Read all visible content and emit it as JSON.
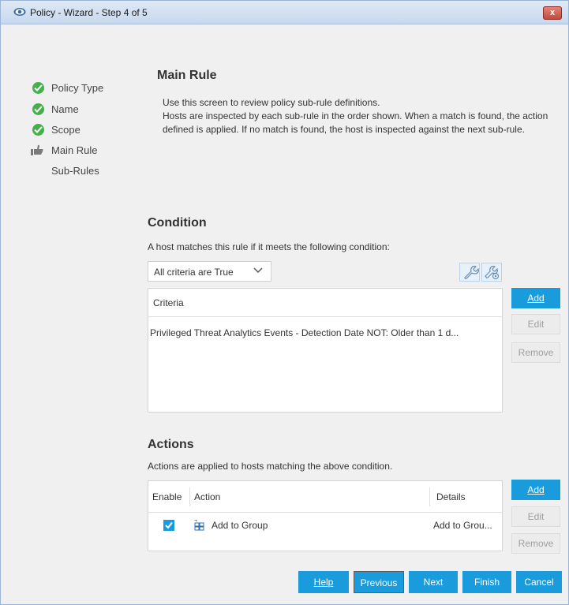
{
  "window": {
    "title": "Policy - Wizard - Step 4 of 5",
    "close_label": "x"
  },
  "steps": [
    {
      "label": "Policy Type",
      "state": "done"
    },
    {
      "label": "Name",
      "state": "done"
    },
    {
      "label": "Scope",
      "state": "done"
    },
    {
      "label": "Main Rule",
      "state": "current"
    },
    {
      "label": "Sub-Rules",
      "state": "pending"
    }
  ],
  "main": {
    "title": "Main Rule",
    "description_1": "Use this screen to review policy sub-rule definitions.",
    "description_2": "Hosts are inspected by each sub-rule in the order shown. When a match is found, the action defined is applied. If no match is found, the host is inspected against the next sub-rule."
  },
  "condition": {
    "title": "Condition",
    "subtitle": "A host matches this rule if it meets the following condition:",
    "dropdown_value": "All criteria are True",
    "criteria_header": "Criteria",
    "criteria_rows": [
      "Privileged Threat Analytics Events - Detection Date NOT: Older than 1 d..."
    ],
    "buttons": {
      "add": "Add",
      "edit": "Edit",
      "remove": "Remove"
    }
  },
  "actions": {
    "title": "Actions",
    "subtitle": "Actions are applied to hosts matching the above condition.",
    "columns": {
      "enable": "Enable",
      "action": "Action",
      "details": "Details"
    },
    "rows": [
      {
        "enabled": true,
        "action": "Add to Group",
        "details": "Add to Grou..."
      }
    ],
    "buttons": {
      "add": "Add",
      "edit": "Edit",
      "remove": "Remove"
    }
  },
  "footer": {
    "help": "Help",
    "previous": "Previous",
    "next": "Next",
    "finish": "Finish",
    "cancel": "Cancel"
  },
  "colors": {
    "accent": "#1a9bdc",
    "check": "#44b04a"
  }
}
